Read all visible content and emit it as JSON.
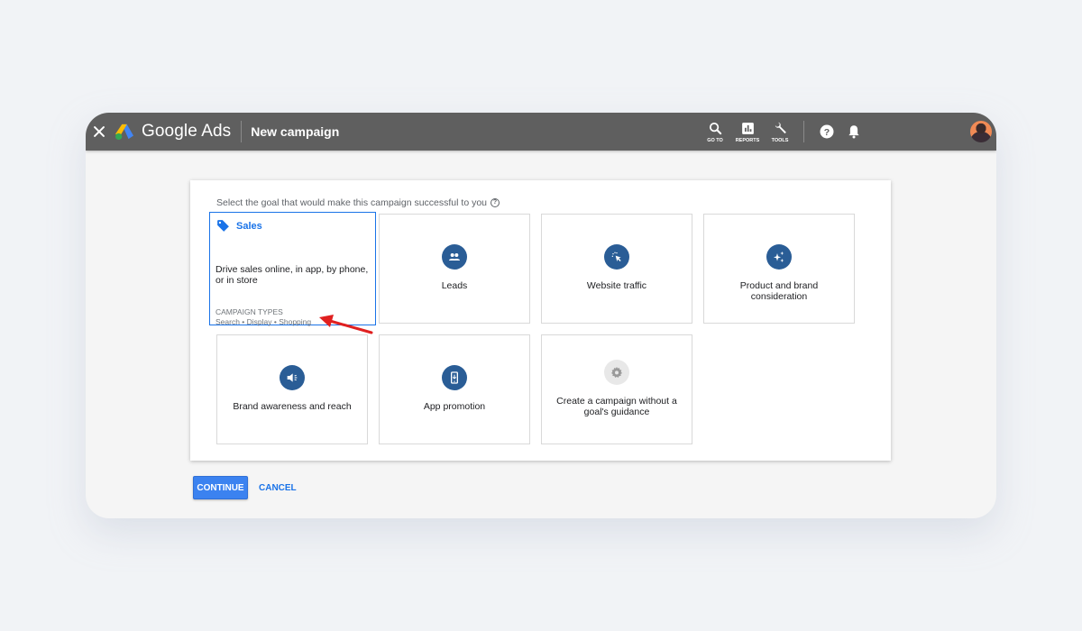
{
  "header": {
    "brand": "Google Ads",
    "page_title": "New campaign",
    "tools": [
      {
        "label": "GO TO",
        "icon": "search-icon"
      },
      {
        "label": "REPORTS",
        "icon": "reports-icon"
      },
      {
        "label": "TOOLS",
        "icon": "wrench-icon"
      }
    ],
    "help_icon": "help-icon",
    "notifications_icon": "bell-icon",
    "avatar": "user-avatar"
  },
  "prompt": {
    "text": "Select the goal that would make this campaign successful to you",
    "help_glyph": "?"
  },
  "goals": [
    {
      "id": "sales",
      "label": "Sales",
      "selected": true,
      "icon": "tag-icon",
      "description": "Drive sales online, in app, by phone, or in store",
      "campaign_types_label": "CAMPAIGN TYPES",
      "campaign_types": "Search • Display • Shopping"
    },
    {
      "id": "leads",
      "label": "Leads",
      "icon": "people-icon"
    },
    {
      "id": "website-traffic",
      "label": "Website traffic",
      "icon": "cursor-click-icon"
    },
    {
      "id": "product-brand",
      "label": "Product and brand consideration",
      "icon": "sparkle-icon"
    },
    {
      "id": "brand-awareness",
      "label": "Brand awareness and reach",
      "icon": "megaphone-icon"
    },
    {
      "id": "app-promotion",
      "label": "App promotion",
      "icon": "phone-download-icon"
    },
    {
      "id": "no-goal",
      "label": "Create a campaign without a goal's guidance",
      "icon": "gear-icon"
    }
  ],
  "actions": {
    "continue": "CONTINUE",
    "cancel": "CANCEL"
  },
  "colors": {
    "accent": "#1a73e8",
    "topbar": "#5f5f5f",
    "goal_icon": "#2a5d96",
    "annotation_arrow": "#e02020"
  }
}
